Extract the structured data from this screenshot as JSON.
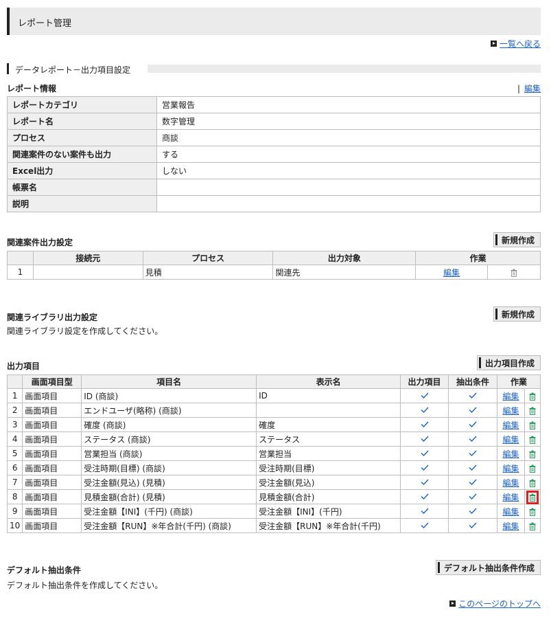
{
  "header": {
    "title": "レポート管理"
  },
  "back_link": "一覧へ戻る",
  "section_title": "データレポート－出力項目設定",
  "report_info": {
    "title": "レポート情報",
    "edit_label": "編集",
    "rows": [
      {
        "label": "レポートカテゴリ",
        "value": "営業報告"
      },
      {
        "label": "レポート名",
        "value": "数字管理"
      },
      {
        "label": "プロセス",
        "value": "商談"
      },
      {
        "label": "関連案件のない案件も出力",
        "value": "する"
      },
      {
        "label": "Excel出力",
        "value": "しない"
      },
      {
        "label": "帳票名",
        "value": ""
      },
      {
        "label": "説明",
        "value": ""
      }
    ]
  },
  "related_cases": {
    "title": "関連案件出力設定",
    "new_button": "新規作成",
    "columns": [
      "接続元",
      "プロセス",
      "出力対象",
      "作業"
    ],
    "rows": [
      {
        "no": "1",
        "source": "",
        "process": "見積",
        "target": "関連先",
        "edit": "編集"
      }
    ]
  },
  "related_library": {
    "title": "関連ライブラリ出力設定",
    "new_button": "新規作成",
    "note": "関連ライブラリ設定を作成してください。"
  },
  "output_items": {
    "title": "出力項目",
    "create_button": "出力項目作成",
    "columns": [
      "画面項目型",
      "項目名",
      "表示名",
      "出力項目",
      "抽出条件",
      "作業"
    ],
    "edit_label": "編集",
    "rows": [
      {
        "no": "1",
        "type": "画面項目",
        "name": "ID (商談)",
        "display": "ID"
      },
      {
        "no": "2",
        "type": "画面項目",
        "name": "エンドユーザ(略称) (商談)",
        "display": ""
      },
      {
        "no": "3",
        "type": "画面項目",
        "name": "確度 (商談)",
        "display": "確度"
      },
      {
        "no": "4",
        "type": "画面項目",
        "name": "ステータス (商談)",
        "display": "ステータス"
      },
      {
        "no": "5",
        "type": "画面項目",
        "name": "営業担当 (商談)",
        "display": "営業担当"
      },
      {
        "no": "6",
        "type": "画面項目",
        "name": "受注時期(目標) (商談)",
        "display": "受注時期(目標)"
      },
      {
        "no": "7",
        "type": "画面項目",
        "name": "受注金額(見込) (見積)",
        "display": "受注金額(見込)"
      },
      {
        "no": "8",
        "type": "画面項目",
        "name": "見積金額(合計) (見積)",
        "display": "見積金額(合計)"
      },
      {
        "no": "9",
        "type": "画面項目",
        "name": "受注金額【INI】(千円) (商談)",
        "display": "受注金額【INI】(千円)"
      },
      {
        "no": "10",
        "type": "画面項目",
        "name": "受注金額【RUN】※年合計(千円) (商談)",
        "display": "受注金額【RUN】※年合計(千円)"
      }
    ]
  },
  "default_conditions": {
    "title": "デフォルト抽出条件",
    "create_button": "デフォルト抽出条件作成",
    "note": "デフォルト抽出条件を作成してください。"
  },
  "top_link": "このページのトップへ",
  "highlight_color": "#e02020"
}
